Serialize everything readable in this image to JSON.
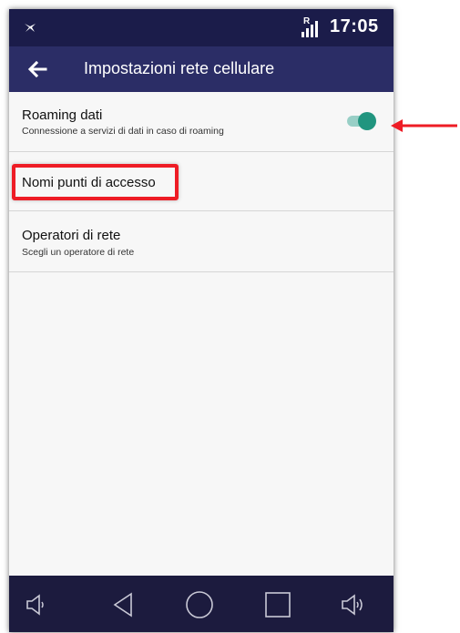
{
  "status_bar": {
    "roaming_indicator": "R",
    "time": "17:05",
    "left_icon": "notification-bird-icon",
    "signal_icon": "signal-bars-icon"
  },
  "app_bar": {
    "title": "Impostazioni rete cellulare",
    "back_icon": "arrow-left-icon"
  },
  "settings": {
    "roaming": {
      "title": "Roaming dati",
      "subtitle": "Connessione a servizi di dati in caso di roaming",
      "enabled": true
    },
    "apn": {
      "title": "Nomi punti di accesso"
    },
    "operators": {
      "title": "Operatori di rete",
      "subtitle": "Scegli un operatore di rete"
    }
  },
  "nav_bar": {
    "icons": [
      "volume-down-icon",
      "back-triangle-icon",
      "home-circle-icon",
      "recents-square-icon",
      "volume-up-icon"
    ]
  },
  "colors": {
    "status_bar": "#1b1c4a",
    "app_bar": "#2b2d66",
    "toggle_on": "#21957f",
    "annotation_red": "#ee1c25"
  }
}
